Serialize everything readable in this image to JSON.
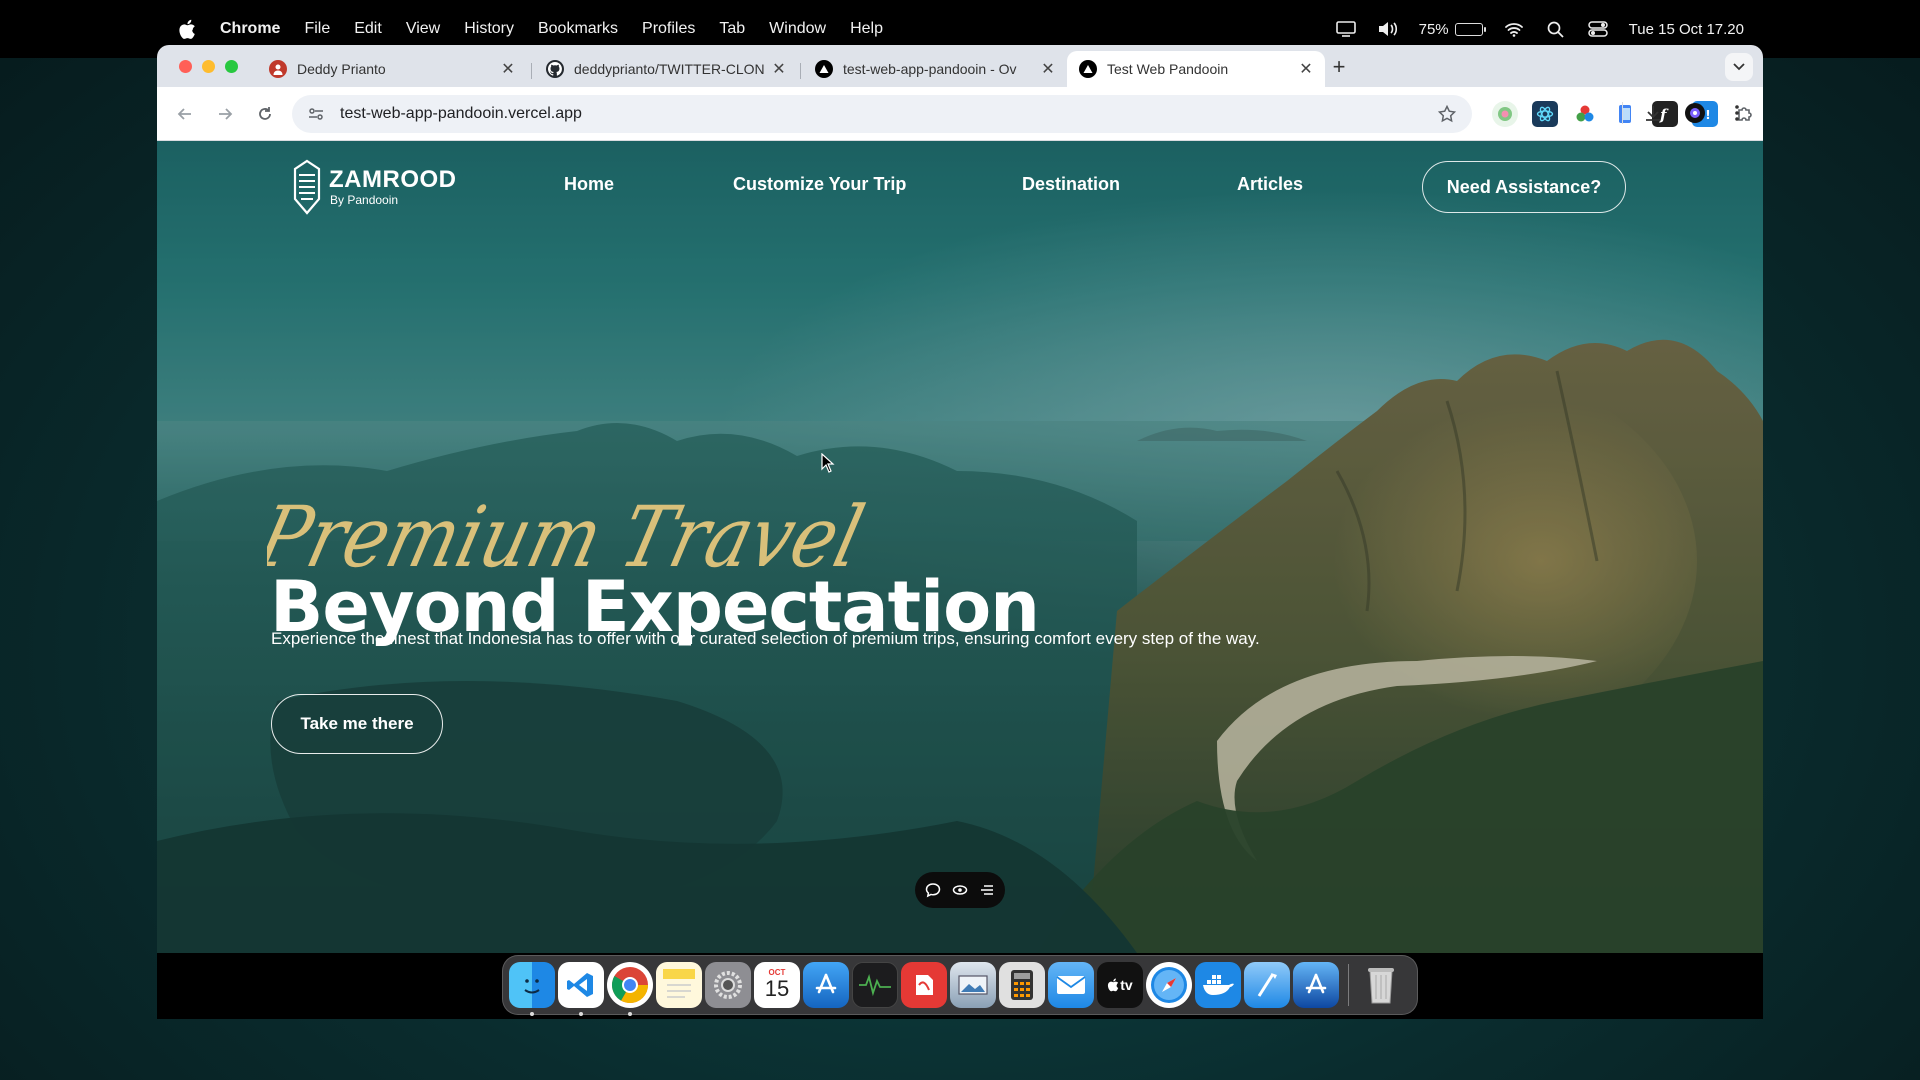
{
  "menubar": {
    "app": "Chrome",
    "items": [
      "File",
      "Edit",
      "View",
      "History",
      "Bookmarks",
      "Profiles",
      "Tab",
      "Window",
      "Help"
    ],
    "battery": "75%",
    "battery_level": 0.75,
    "datetime": "Tue 15 Oct 17.20"
  },
  "browser": {
    "tabs": [
      {
        "title": "Deddy Prianto",
        "favicon": "avatar-icon",
        "active": false
      },
      {
        "title": "deddyprianto/TWITTER-CLONE",
        "favicon": "github-icon",
        "active": false
      },
      {
        "title": "test-web-app-pandooin - Ov",
        "favicon": "vercel-icon",
        "active": false
      },
      {
        "title": "Test Web Pandooin",
        "favicon": "vercel-icon",
        "active": true
      }
    ],
    "url": "test-web-app-pandooin.vercel.app"
  },
  "site": {
    "logo_name": "ZAMROOD",
    "logo_sub": "By Pandooin",
    "nav": [
      "Home",
      "Customize Your Trip",
      "Destination",
      "Articles"
    ],
    "assist_label": "Need Assistance?",
    "hero_script": "Premium Travel",
    "hero_title": "Beyond Expectation",
    "hero_sub": "Experience the finest that Indonesia has to offer with our curated selection of premium trips, ensuring comfort every step of the way.",
    "cta_label": "Take me there"
  },
  "dock": {
    "calendar_month": "OCT",
    "calendar_day": "15",
    "appletv_label": "tv"
  },
  "colors": {
    "accent_gold": "#d9c07a",
    "hero_teal": "#1f6a6b"
  }
}
